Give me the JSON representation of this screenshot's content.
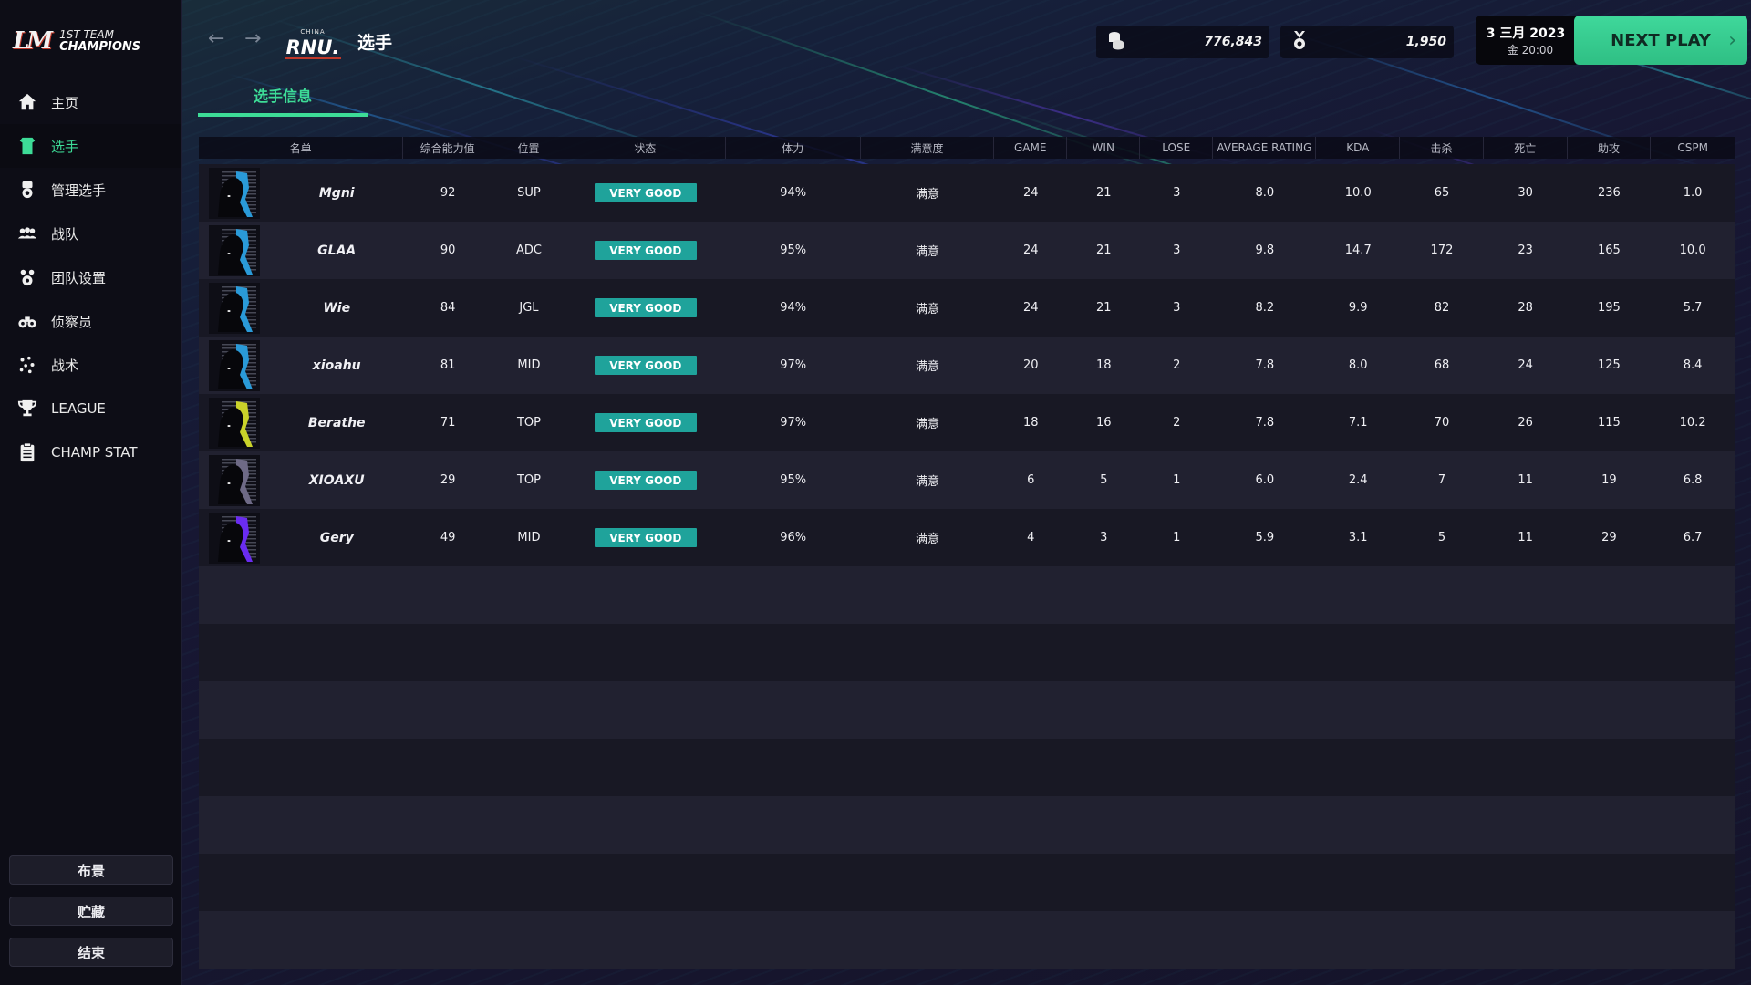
{
  "app": {
    "logo_mark": "LM",
    "logo_line1": "1ST TEAM",
    "logo_line2": "CHAMPIONS"
  },
  "sidebar": {
    "items": [
      {
        "label": "主页",
        "icon": "home-icon",
        "active": false
      },
      {
        "label": "选手",
        "icon": "jersey-icon",
        "active": true
      },
      {
        "label": "管理选手",
        "icon": "manage-player-icon",
        "active": false
      },
      {
        "label": "战队",
        "icon": "team-icon",
        "active": false
      },
      {
        "label": "团队设置",
        "icon": "team-settings-icon",
        "active": false
      },
      {
        "label": "侦察员",
        "icon": "binoculars-icon",
        "active": false
      },
      {
        "label": "战术",
        "icon": "tactics-icon",
        "active": false
      },
      {
        "label": "LEAGUE",
        "icon": "trophy-icon",
        "active": false
      },
      {
        "label": "CHAMP STAT",
        "icon": "clipboard-icon",
        "active": false
      }
    ],
    "bottom_buttons": [
      "布景",
      "贮藏",
      "结束"
    ]
  },
  "header": {
    "back_icon": "←",
    "forward_icon": "→",
    "team_logo_top": "CHINA",
    "team_logo_name": "RNU.",
    "title": "选手",
    "money": "776,843",
    "fans": "1,950",
    "date_line1": "3 三月 2023",
    "date_line2": "金 20:00",
    "next_play": "NEXT PLAY",
    "next_chevron": "›"
  },
  "tabs": [
    {
      "label": "选手信息",
      "active": true
    }
  ],
  "colors": {
    "accent": "#3ddc97",
    "badge": "#1fa39b",
    "avatar_blue": "#2a9ad8",
    "avatar_yellow": "#c9d22a",
    "avatar_gray": "#6e6a86",
    "avatar_purple": "#6a2cf0"
  },
  "table": {
    "columns": [
      "名单",
      "综合能力值",
      "位置",
      "状态",
      "体力",
      "满意度",
      "GAME",
      "WIN",
      "LOSE",
      "AVERAGE RATING",
      "KDA",
      "击杀",
      "死亡",
      "助攻",
      "CSPM"
    ],
    "rows": [
      {
        "name": "Mgni",
        "ovr": "92",
        "pos": "SUP",
        "status": "VERY GOOD",
        "stamina": "94%",
        "satisfaction": "满意",
        "game": "24",
        "win": "21",
        "lose": "3",
        "avg": "8.0",
        "kda": "10.0",
        "kills": "65",
        "deaths": "30",
        "assists": "236",
        "cspm": "1.0",
        "avatar_color": "#2a9ad8"
      },
      {
        "name": "GLAA",
        "ovr": "90",
        "pos": "ADC",
        "status": "VERY GOOD",
        "stamina": "95%",
        "satisfaction": "满意",
        "game": "24",
        "win": "21",
        "lose": "3",
        "avg": "9.8",
        "kda": "14.7",
        "kills": "172",
        "deaths": "23",
        "assists": "165",
        "cspm": "10.0",
        "avatar_color": "#2a9ad8"
      },
      {
        "name": "Wie",
        "ovr": "84",
        "pos": "JGL",
        "status": "VERY GOOD",
        "stamina": "94%",
        "satisfaction": "满意",
        "game": "24",
        "win": "21",
        "lose": "3",
        "avg": "8.2",
        "kda": "9.9",
        "kills": "82",
        "deaths": "28",
        "assists": "195",
        "cspm": "5.7",
        "avatar_color": "#2a9ad8"
      },
      {
        "name": "xioahu",
        "ovr": "81",
        "pos": "MID",
        "status": "VERY GOOD",
        "stamina": "97%",
        "satisfaction": "满意",
        "game": "20",
        "win": "18",
        "lose": "2",
        "avg": "7.8",
        "kda": "8.0",
        "kills": "68",
        "deaths": "24",
        "assists": "125",
        "cspm": "8.4",
        "avatar_color": "#2a9ad8"
      },
      {
        "name": "Berathe",
        "ovr": "71",
        "pos": "TOP",
        "status": "VERY GOOD",
        "stamina": "97%",
        "satisfaction": "满意",
        "game": "18",
        "win": "16",
        "lose": "2",
        "avg": "7.8",
        "kda": "7.1",
        "kills": "70",
        "deaths": "26",
        "assists": "115",
        "cspm": "10.2",
        "avatar_color": "#c9d22a"
      },
      {
        "name": "XIOAXU",
        "ovr": "29",
        "pos": "TOP",
        "status": "VERY GOOD",
        "stamina": "95%",
        "satisfaction": "满意",
        "game": "6",
        "win": "5",
        "lose": "1",
        "avg": "6.0",
        "kda": "2.4",
        "kills": "7",
        "deaths": "11",
        "assists": "19",
        "cspm": "6.8",
        "avatar_color": "#6e6a86"
      },
      {
        "name": "Gery",
        "ovr": "49",
        "pos": "MID",
        "status": "VERY GOOD",
        "stamina": "96%",
        "satisfaction": "满意",
        "game": "4",
        "win": "3",
        "lose": "1",
        "avg": "5.9",
        "kda": "3.1",
        "kills": "5",
        "deaths": "11",
        "assists": "29",
        "cspm": "6.7",
        "avatar_color": "#6a2cf0"
      }
    ],
    "empty_rows": 7
  }
}
